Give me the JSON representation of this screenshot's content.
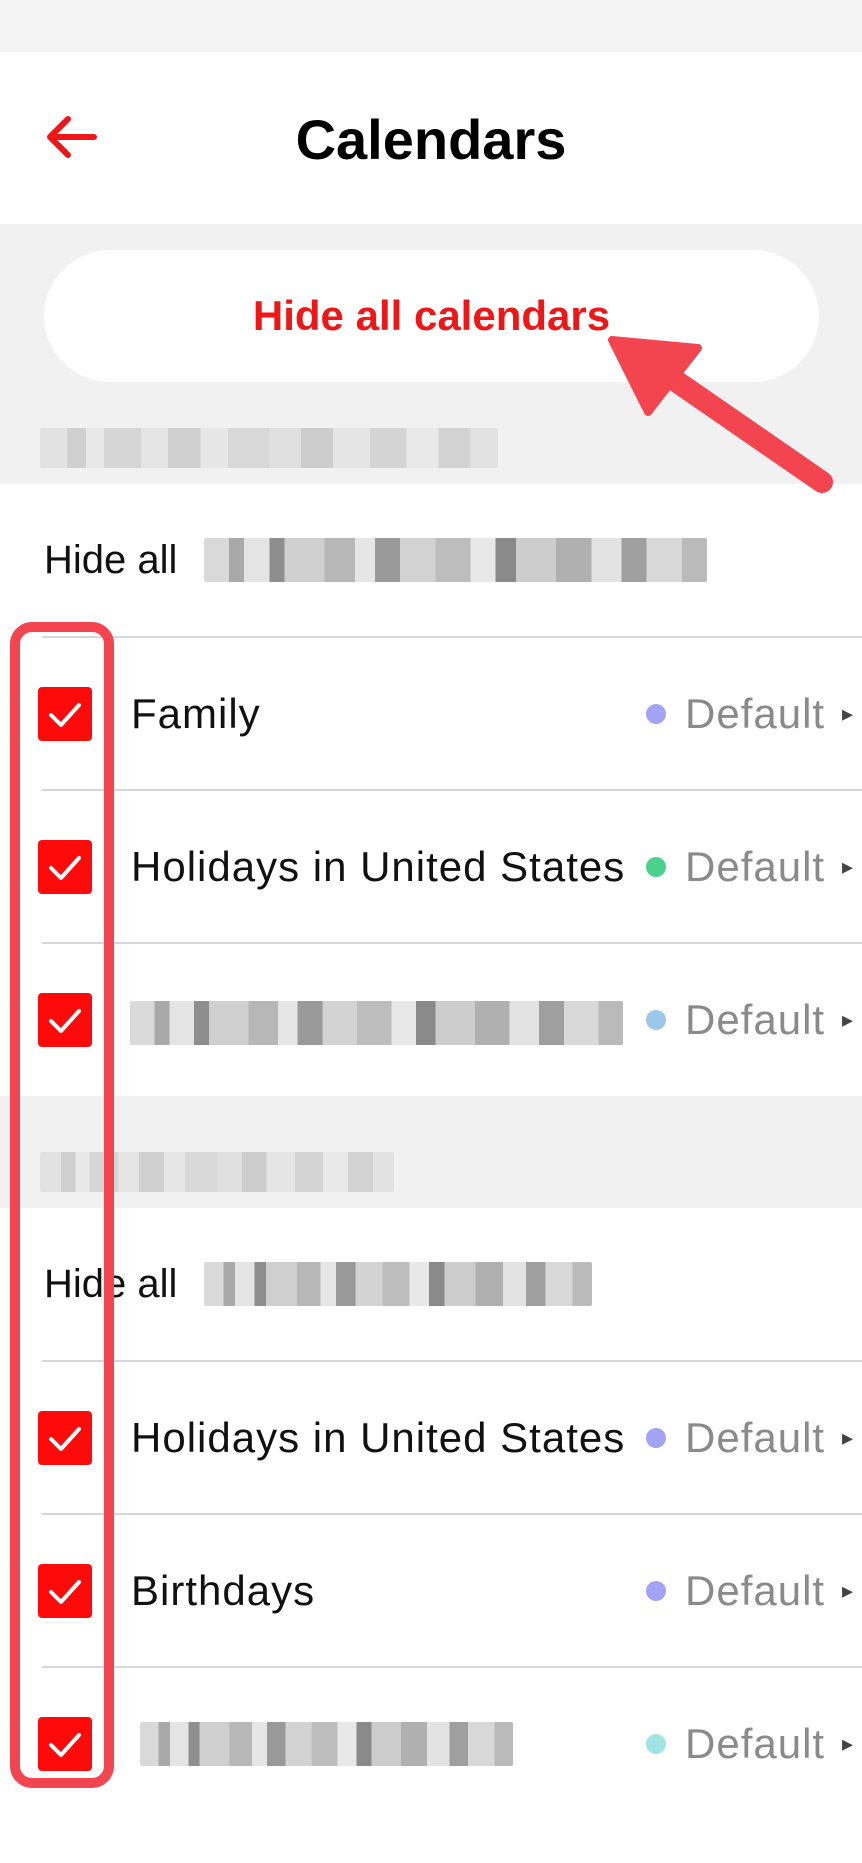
{
  "header": {
    "title": "Calendars",
    "back_icon": "arrow-left-icon"
  },
  "hide_all_calendars_label": "Hide all calendars",
  "hide_all_prefix": "Hide all",
  "colors": {
    "accent": "#ee1616",
    "checkbox": "#ff0a0a",
    "highlight": "#f24550"
  },
  "sections": [
    {
      "calendars": [
        {
          "name": "Family",
          "color": "#a3a3f5",
          "default_label": "Default"
        },
        {
          "name": "Holidays in United States",
          "color": "#4cd18c",
          "default_label": "Default"
        },
        {
          "name": "",
          "color": "#9cc7e8",
          "default_label": "Default"
        }
      ]
    },
    {
      "calendars": [
        {
          "name": "Holidays in United States",
          "color": "#a3a3f5",
          "default_label": "Default"
        },
        {
          "name": "Birthdays",
          "color": "#a3a3f5",
          "default_label": "Default"
        },
        {
          "name": "",
          "color": "#9fe3e3",
          "default_label": "Default"
        }
      ]
    }
  ]
}
